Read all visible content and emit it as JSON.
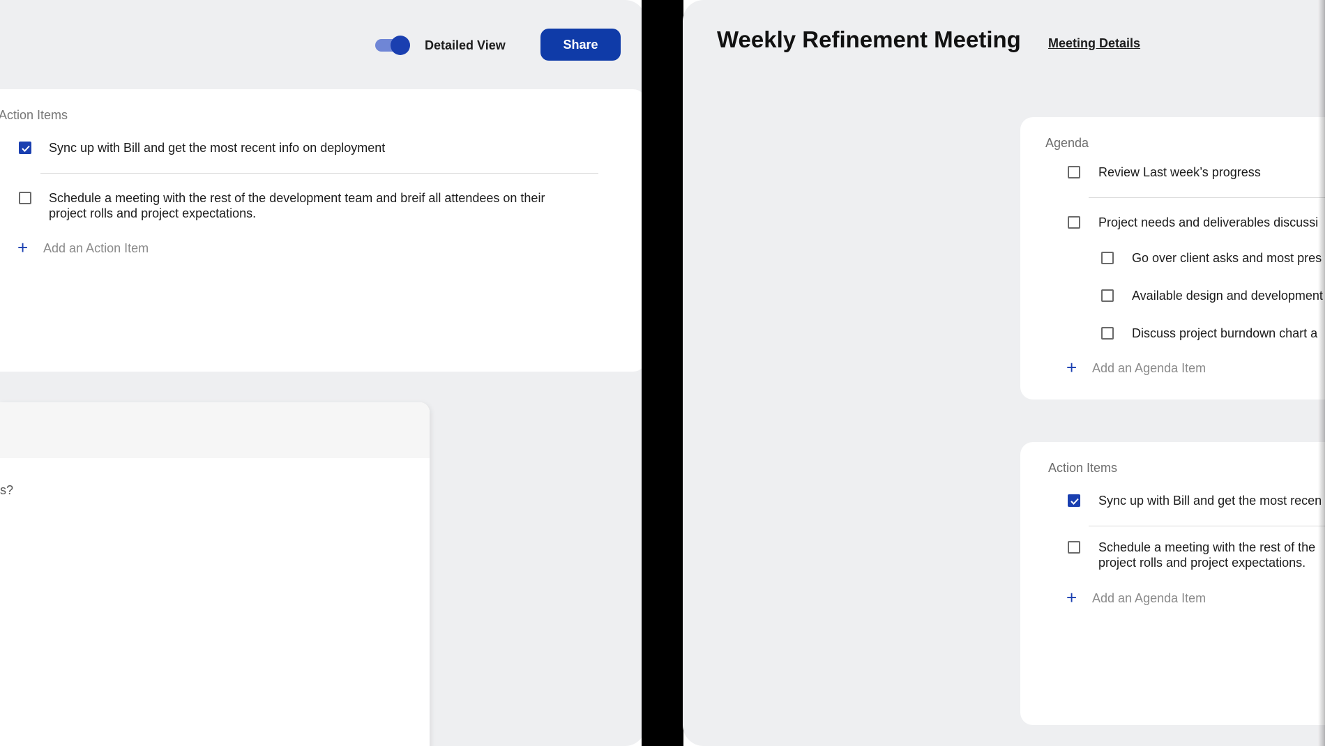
{
  "header": {
    "toggle_label": "Detailed View",
    "share_label": "Share",
    "meeting_title": "Weekly Refinement Meeting",
    "meeting_details_link": "Meeting Details"
  },
  "left_action_items": {
    "label": "Action Items",
    "items": [
      {
        "text": "Sync up with Bill and get the most recent info on deployment",
        "checked": true
      },
      {
        "text_line1": "Schedule a meeting with the rest of the development team and breif all attendees on their",
        "text_line2": "project rolls and project expectations.",
        "checked": false
      }
    ],
    "add_label": "Add an Action Item"
  },
  "left_lower_card": {
    "question_fragment": "s?"
  },
  "agenda": {
    "label": "Agenda",
    "items": [
      {
        "text": "Review Last week’s progress",
        "checked": false
      },
      {
        "text": "Project needs and deliverables discussi",
        "checked": false
      },
      {
        "text": "Go over client asks and most pres",
        "checked": false
      },
      {
        "text": "Available design and development",
        "checked": false
      },
      {
        "text": "Discuss project burndown chart a",
        "checked": false
      }
    ],
    "add_label": "Add an Agenda Item"
  },
  "right_action_items": {
    "label": "Action Items",
    "items": [
      {
        "text": "Sync up with Bill and get the most recen",
        "checked": true
      },
      {
        "text_line1": "Schedule a meeting with the rest of the",
        "text_line2": "project rolls and project expectations.",
        "checked": false
      }
    ],
    "add_label": "Add an Agenda Item"
  },
  "colors": {
    "accent": "#1a3fb0",
    "panel_bg": "#eeeff1",
    "card_bg": "#ffffff"
  }
}
